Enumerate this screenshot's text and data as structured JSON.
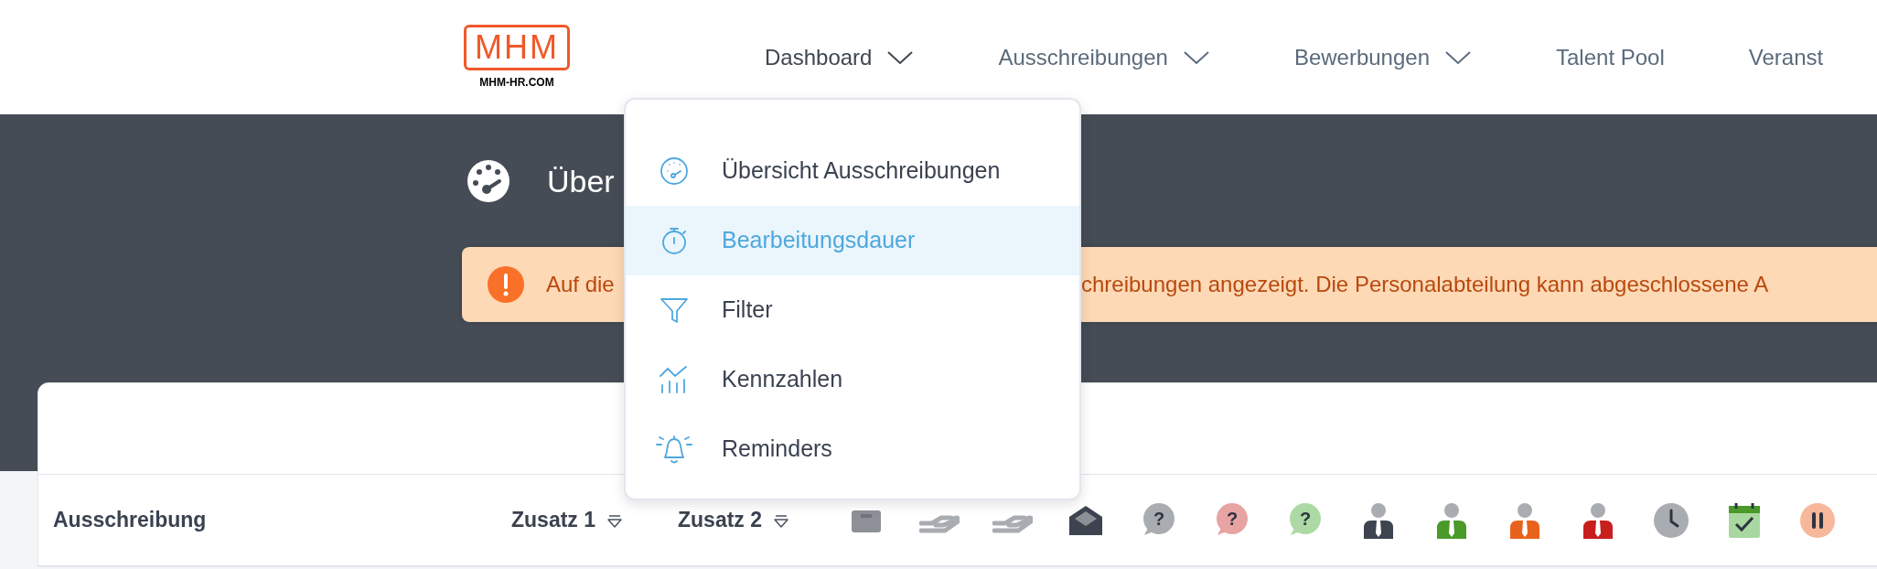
{
  "logo": {
    "mark": "MHM",
    "caption": "MHM-HR.COM"
  },
  "nav": [
    {
      "label": "Dashboard",
      "has_caret": true,
      "selected": true
    },
    {
      "label": "Ausschreibungen",
      "has_caret": true,
      "selected": false
    },
    {
      "label": "Bewerbungen",
      "has_caret": true,
      "selected": false
    },
    {
      "label": "Talent Pool",
      "has_caret": false,
      "selected": false
    },
    {
      "label": "Veranst",
      "has_caret": false,
      "selected": false
    }
  ],
  "page": {
    "title": "Über"
  },
  "alert": {
    "text_before": "Auf die",
    "text_after": "chreibungen angezeigt. Die Personalabteilung kann abgeschlossene A"
  },
  "dropdown": {
    "items": [
      {
        "label": "Übersicht Ausschreibungen",
        "selected": false
      },
      {
        "label": "Bearbeitungsdauer",
        "selected": true
      },
      {
        "label": "Filter",
        "selected": false
      },
      {
        "label": "Kennzahlen",
        "selected": false
      },
      {
        "label": "Reminders",
        "selected": false
      }
    ]
  },
  "table": {
    "columns": [
      {
        "label": "Ausschreibung",
        "sortable": false
      },
      {
        "label": "Zusatz 1",
        "sortable": true
      },
      {
        "label": "Zusatz 2",
        "sortable": true
      }
    ],
    "status_columns": [
      {
        "kind": "tray"
      },
      {
        "kind": "hand"
      },
      {
        "kind": "hand"
      },
      {
        "kind": "envelope"
      },
      {
        "kind": "question",
        "color": "#a9acb1",
        "symbol": "?"
      },
      {
        "kind": "question",
        "color": "#e8a3a3",
        "symbol": "?"
      },
      {
        "kind": "question",
        "color": "#acd9a4",
        "symbol": "?"
      },
      {
        "kind": "person",
        "color": "#3d4450"
      },
      {
        "kind": "person",
        "color": "#4a9a2a"
      },
      {
        "kind": "person",
        "color": "#e8621c"
      },
      {
        "kind": "person",
        "color": "#c81e1e"
      },
      {
        "kind": "clock"
      },
      {
        "kind": "calendar"
      },
      {
        "kind": "pause"
      }
    ]
  }
}
